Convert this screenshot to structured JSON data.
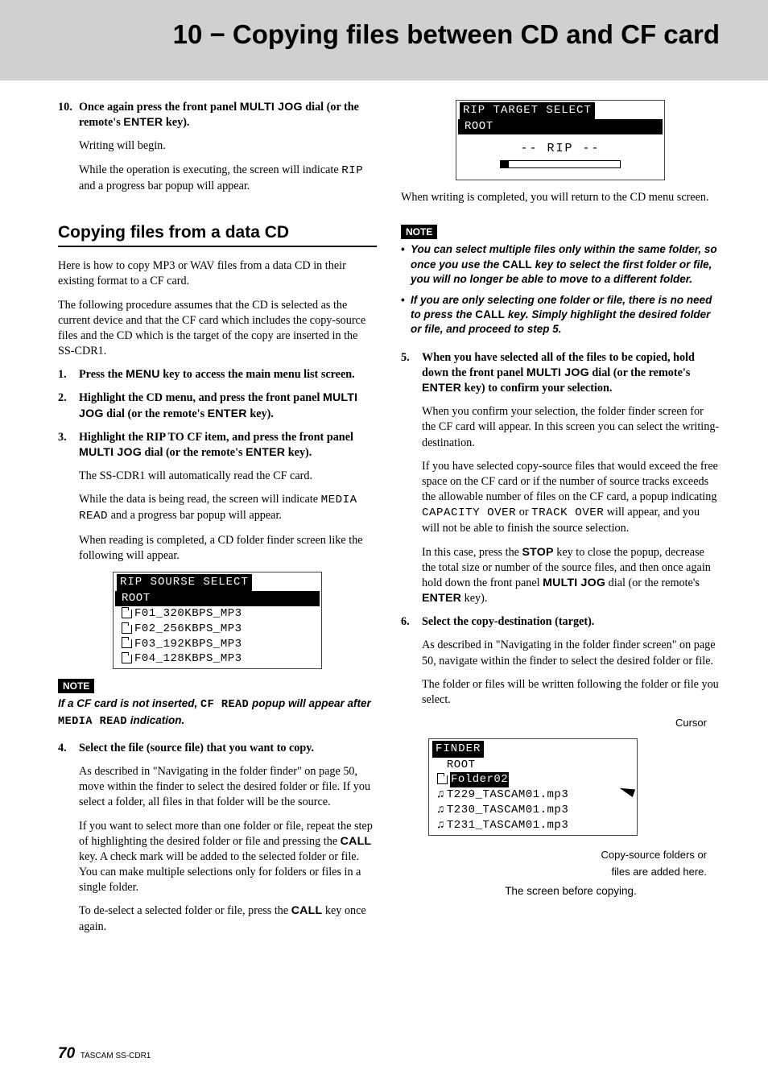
{
  "header": {
    "title": "10 − Copying files between CD and CF card"
  },
  "section": {
    "title": "Copying files from a data CD"
  },
  "left": {
    "step10_num": "10.",
    "step10_a": "Once again press the front panel ",
    "step10_b": "MULTI JOG",
    "step10_c": " dial (or the remote's ",
    "step10_d": "ENTER",
    "step10_e": " key).",
    "writing": "Writing will begin.",
    "exec_a": "While the operation is executing, the screen will indicate ",
    "exec_b": "RIP",
    "exec_c": " and a progress bar popup will appear.",
    "intro1": "Here is how to copy MP3 or WAV files from a data CD in their existing format to a CF card.",
    "intro2": "The following procedure assumes that the CD is selected as the current device and that the CF card which includes the copy-source files and the CD which is the target of the copy are inserted in the SS-CDR1.",
    "s1_num": "1.",
    "s1_a": "Press the ",
    "s1_b": "MENU",
    "s1_c": " key to access the main menu list screen.",
    "s2_num": "2.",
    "s2_a": "Highlight the CD menu, and press the front panel ",
    "s2_b": "MULTI JOG",
    "s2_c": " dial (or the remote's ",
    "s2_d": "ENTER",
    "s2_e": " key).",
    "s3_num": "3.",
    "s3_a": "Highlight the RIP TO CF item, and press the front panel ",
    "s3_b": "MULTI JOG",
    "s3_c": " dial (or the remote's ",
    "s3_d": "ENTER",
    "s3_e": " key).",
    "s3_p1": "The SS-CDR1 will automatically read the CF card.",
    "s3_p2a": "While the data is being read, the screen will indicate ",
    "s3_p2b": "MEDIA READ",
    "s3_p2c": " and a progress bar popup will appear.",
    "s3_p3": "When reading is completed, a CD folder finder screen like the following will appear.",
    "lcd1_title": "RIP SOURSE SELECT",
    "lcd1_root": "ROOT",
    "lcd1_r1": "F01_320KBPS_MP3",
    "lcd1_r2": "F02_256KBPS_MP3",
    "lcd1_r3": "F03_192KBPS_MP3",
    "lcd1_r4": "F04_128KBPS_MP3",
    "note1_badge": "NOTE",
    "note1_a": "If a CF card is not inserted, ",
    "note1_b": "CF READ",
    "note1_c": " popup will appear after ",
    "note1_d": "MEDIA READ",
    "note1_e": " indication.",
    "s4_num": "4.",
    "s4": "Select the file (source file) that you want to copy.",
    "s4_p1": "As described in \"Navigating in the folder finder\" on page 50, move within the finder to select the desired folder or file. If you select a folder, all files in that folder will be the source.",
    "s4_p2a": "If you want to select more than one folder or file, repeat the step of highlighting the desired folder or file and pressing the ",
    "s4_p2b": "CALL",
    "s4_p2c": " key. A check mark will be added to the selected folder or file. You can make multiple selections only for folders or files in a single folder.",
    "s4_p3a": "To de-select a selected folder or file, press the ",
    "s4_p3b": "CALL",
    "s4_p3c": " key once again."
  },
  "right": {
    "lcd2_title": "RIP TARGET SELECT",
    "lcd2_root": "ROOT",
    "lcd2_rip": "-- RIP --",
    "after": "When writing is completed, you will return to the CD menu screen.",
    "note2_badge": "NOTE",
    "note2_li1a": "You can select multiple files only within the same folder, so once you use the ",
    "note2_li1b": "CALL",
    "note2_li1c": " key to select the first folder or file, you will no longer be able to move to a different folder.",
    "note2_li2a": "If you are only selecting one folder or file, there is no need to press the ",
    "note2_li2b": "CALL",
    "note2_li2c": " key. Simply highlight the desired folder or file, and proceed to step 5.",
    "s5_num": "5.",
    "s5_a": "When you have selected all of the files to be copied, hold down the front panel ",
    "s5_b": "MULTI JOG",
    "s5_c": " dial (or the remote's ",
    "s5_d": "ENTER",
    "s5_e": " key) to confirm your selection.",
    "s5_p1": "When you confirm your selection, the folder finder screen for the CF card will appear. In this screen you can select the writing-destination.",
    "s5_p2a": "If you have selected copy-source files that would exceed the free space on the CF card or if the number of source tracks exceeds the allowable number of files on the CF card, a popup indicating ",
    "s5_p2b": "CAPACITY OVER",
    "s5_p2c": " or ",
    "s5_p2d": "TRACK OVER",
    "s5_p2e": " will appear, and you will not be able to finish the source selection.",
    "s5_p3a": "In this case, press the ",
    "s5_p3b": "STOP",
    "s5_p3c": " key to close the popup, decrease the total size or number of the source files, and then once again hold down the front panel ",
    "s5_p3d": "MULTI JOG",
    "s5_p3e": " dial (or the remote's ",
    "s5_p3f": "ENTER",
    "s5_p3g": " key).",
    "s6_num": "6.",
    "s6": "Select the copy-destination (target).",
    "s6_p1": "As described in \"Navigating in the folder finder screen\" on page 50, navigate within the finder to select the desired folder or file.",
    "s6_p2": "The folder or files will be written following the folder or file you select.",
    "lcd3_cursor": "Cursor",
    "lcd3_title": "FINDER",
    "lcd3_root": "ROOT",
    "lcd3_folder": "Folder02",
    "lcd3_t1": "T229_TASCAM01.mp3",
    "lcd3_t2": "T230_TASCAM01.mp3",
    "lcd3_t3": "T231_TASCAM01.mp3",
    "lcd3_cap1": "Copy-source folders or",
    "lcd3_cap2": "files are added here.",
    "lcd3_bottom": "The screen before copying."
  },
  "footer": {
    "page": "70",
    "product": "TASCAM  SS-CDR1"
  }
}
